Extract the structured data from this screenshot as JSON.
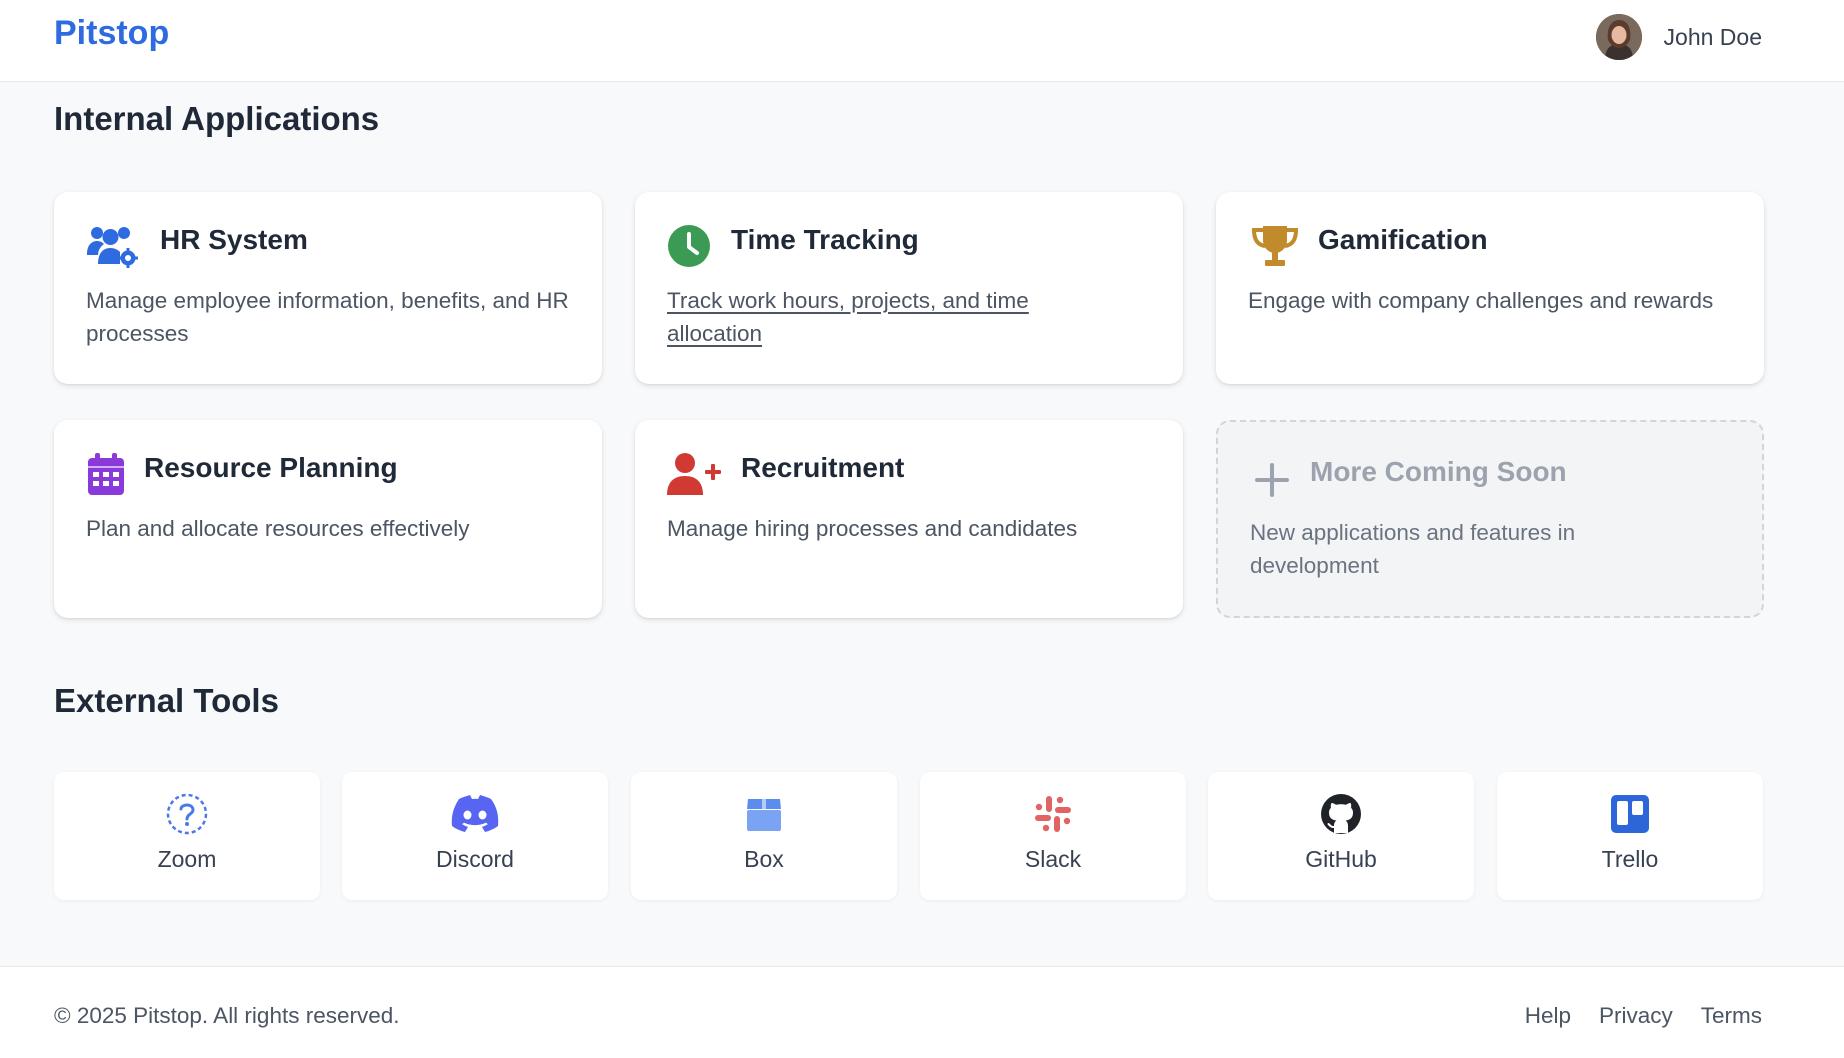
{
  "header": {
    "brand": "Pitstop",
    "user_name": "John Doe"
  },
  "internal": {
    "title": "Internal Applications",
    "apps": [
      {
        "title": "HR System",
        "description": "Manage employee information, benefits, and HR processes",
        "icon": "users-gear-icon",
        "color": "#2f6be0"
      },
      {
        "title": "Time Tracking",
        "description": "Track work hours, projects, and time allocation",
        "icon": "clock-icon",
        "color": "#3b9b54"
      },
      {
        "title": "Gamification",
        "description": "Engage with company challenges and rewards",
        "icon": "trophy-icon",
        "color": "#c18a2a"
      },
      {
        "title": "Resource Planning",
        "description": "Plan and allocate resources effectively",
        "icon": "calendar-icon",
        "color": "#8a3ad9"
      },
      {
        "title": "Recruitment",
        "description": "Manage hiring processes and candidates",
        "icon": "user-plus-icon",
        "color": "#d13a32"
      },
      {
        "title": "More Coming Soon",
        "description": "New applications and features in development",
        "icon": "plus-icon",
        "color": "#9ca3af"
      }
    ]
  },
  "external": {
    "title": "External Tools",
    "tools": [
      {
        "label": "Zoom",
        "icon": "question-circle-icon",
        "color": "#4a7ae8"
      },
      {
        "label": "Discord",
        "icon": "discord-icon",
        "color": "#5865f2"
      },
      {
        "label": "Box",
        "icon": "box-icon",
        "color": "#5b8def"
      },
      {
        "label": "Slack",
        "icon": "slack-icon",
        "color": "#e06464"
      },
      {
        "label": "GitHub",
        "icon": "github-icon",
        "color": "#1f2328"
      },
      {
        "label": "Trello",
        "icon": "trello-icon",
        "color": "#2c66d8"
      }
    ]
  },
  "footer": {
    "copyright": "© 2025 Pitstop. All rights reserved.",
    "links": [
      "Help",
      "Privacy",
      "Terms"
    ]
  }
}
